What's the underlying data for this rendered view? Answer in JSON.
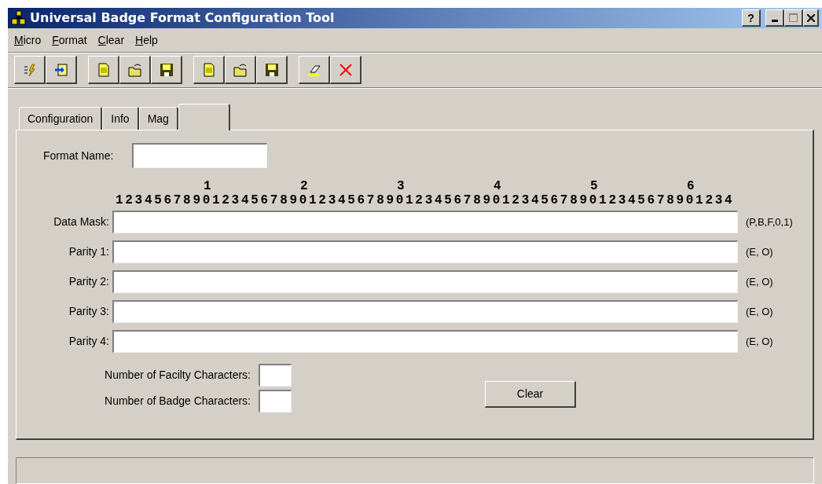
{
  "window": {
    "title": "Universal Badge Format Configuration Tool",
    "controls": [
      "?"
    ]
  },
  "menu": [
    "Micro",
    "Format",
    "Clear",
    "Help"
  ],
  "tabs": [
    {
      "label": "Configuration",
      "selected": false
    },
    {
      "label": "Info",
      "selected": false
    },
    {
      "label": "Mag",
      "selected": false
    },
    {
      "selected": true
    }
  ],
  "format_name": {
    "label": "Format Name:"
  },
  "ruler": {
    "tens": [
      "1",
      "2",
      "3",
      "4",
      "5",
      "6"
    ],
    "digits": "1234567890123456789012345678901234567890123456789012345678901234"
  },
  "rows": [
    {
      "label": "Data Mask:",
      "hint": "(P,B,F,0,1)"
    },
    {
      "label": "Parity 1:",
      "hint": "(E, O)"
    },
    {
      "label": "Parity 2:",
      "hint": "(E, O)"
    },
    {
      "label": "Parity 3:",
      "hint": "(E, O)"
    },
    {
      "label": "Parity 4:",
      "hint": "(E, O)"
    }
  ],
  "counts": [
    {
      "label": "Number of Facilty Characters:"
    },
    {
      "label": "Number of Badge Characters:"
    }
  ],
  "clear_button": "Clear"
}
